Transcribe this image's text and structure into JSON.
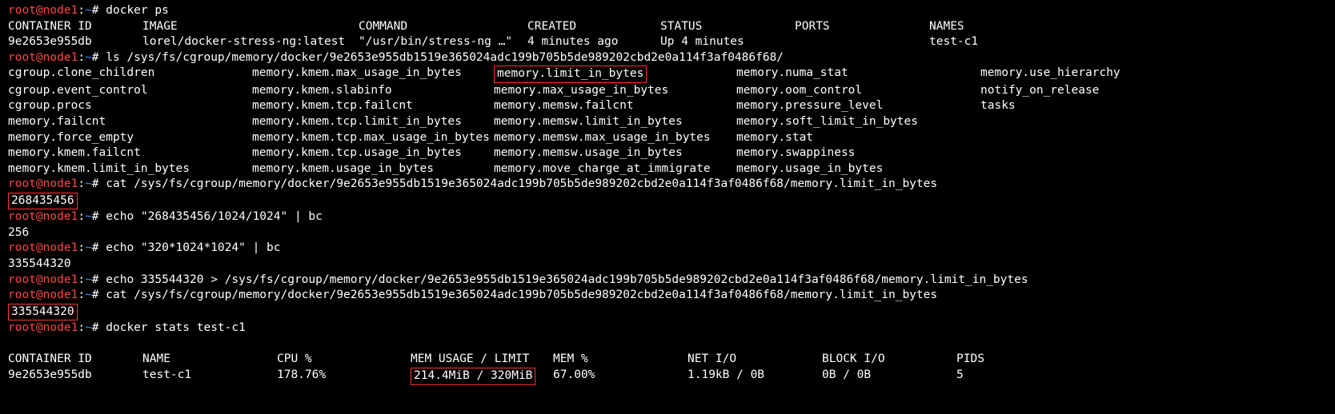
{
  "prompts": {
    "user_host": "root@node1",
    "sep1": ":",
    "path": "~",
    "sep2": "# "
  },
  "commands": {
    "docker_ps": "docker ps",
    "ls_cgroup": "ls /sys/fs/cgroup/memory/docker/9e2653e955db1519e365024adc199b705b5de989202cbd2e0a114f3af0486f68/",
    "cat_limit1": "cat /sys/fs/cgroup/memory/docker/9e2653e955db1519e365024adc199b705b5de989202cbd2e0a114f3af0486f68/memory.limit_in_bytes",
    "echo_calc1": "echo \"268435456/1024/1024\" | bc",
    "echo_calc2": "echo \"320*1024*1024\" | bc",
    "echo_redirect": "echo 335544320 > /sys/fs/cgroup/memory/docker/9e2653e955db1519e365024adc199b705b5de989202cbd2e0a114f3af0486f68/memory.limit_in_bytes",
    "cat_limit2": "cat /sys/fs/cgroup/memory/docker/9e2653e955db1519e365024adc199b705b5de989202cbd2e0a114f3af0486f68/memory.limit_in_bytes",
    "docker_stats": "docker stats test-c1"
  },
  "ps_headers": {
    "id": "CONTAINER ID",
    "image": "IMAGE",
    "command": "COMMAND",
    "created": "CREATED",
    "status": "STATUS",
    "ports": "PORTS",
    "names": "NAMES"
  },
  "ps_row": {
    "id": "9e2653e955db",
    "image": "lorel/docker-stress-ng:latest",
    "command": "\"/usr/bin/stress-ng …\"",
    "created": "4 minutes ago",
    "status": "Up 4 minutes",
    "ports": "",
    "names": "test-c1"
  },
  "cgroup_files": {
    "r1": {
      "a": "cgroup.clone_children",
      "b": "memory.kmem.max_usage_in_bytes",
      "c": "memory.limit_in_bytes",
      "d": "memory.numa_stat",
      "e": "memory.use_hierarchy"
    },
    "r2": {
      "a": "cgroup.event_control",
      "b": "memory.kmem.slabinfo",
      "c": "memory.max_usage_in_bytes",
      "d": "memory.oom_control",
      "e": "notify_on_release"
    },
    "r3": {
      "a": "cgroup.procs",
      "b": "memory.kmem.tcp.failcnt",
      "c": "memory.memsw.failcnt",
      "d": "memory.pressure_level",
      "e": "tasks"
    },
    "r4": {
      "a": "memory.failcnt",
      "b": "memory.kmem.tcp.limit_in_bytes",
      "c": "memory.memsw.limit_in_bytes",
      "d": "memory.soft_limit_in_bytes",
      "e": ""
    },
    "r5": {
      "a": "memory.force_empty",
      "b": "memory.kmem.tcp.max_usage_in_bytes",
      "c": "memory.memsw.max_usage_in_bytes",
      "d": "memory.stat",
      "e": ""
    },
    "r6": {
      "a": "memory.kmem.failcnt",
      "b": "memory.kmem.tcp.usage_in_bytes",
      "c": "memory.memsw.usage_in_bytes",
      "d": "memory.swappiness",
      "e": ""
    },
    "r7": {
      "a": "memory.kmem.limit_in_bytes",
      "b": "memory.kmem.usage_in_bytes",
      "c": "memory.move_charge_at_immigrate",
      "d": "memory.usage_in_bytes",
      "e": ""
    }
  },
  "outputs": {
    "limit1": "268435456",
    "calc1": "256",
    "calc2": "335544320",
    "limit2": "335544320"
  },
  "stats_headers": {
    "id": "CONTAINER ID",
    "name": "NAME",
    "cpu": "CPU %",
    "mem_usage": "MEM USAGE / LIMIT",
    "mem_pct": "MEM %",
    "netio": "NET I/O",
    "blockio": "BLOCK I/O",
    "pids": "PIDS"
  },
  "stats_row": {
    "id": "9e2653e955db",
    "name": "test-c1",
    "cpu": "178.76%",
    "mem_usage": "214.4MiB / 320MiB",
    "mem_pct": "67.00%",
    "netio": "1.19kB / 0B",
    "blockio": "0B / 0B",
    "pids": "5"
  }
}
